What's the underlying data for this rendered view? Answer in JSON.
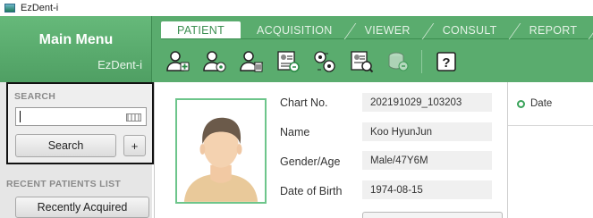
{
  "app": {
    "title": "EzDent-i"
  },
  "main_menu": {
    "title": "Main Menu",
    "subtitle": "EzDent-i"
  },
  "tabs": [
    {
      "label": "PATIENT",
      "active": true
    },
    {
      "label": "ACQUISITION",
      "active": false
    },
    {
      "label": "VIEWER",
      "active": false
    },
    {
      "label": "CONSULT",
      "active": false
    },
    {
      "label": "REPORT",
      "active": false
    }
  ],
  "toolbar_icons": [
    "add-patient-icon",
    "edit-patient-icon",
    "delete-patient-icon",
    "patient-card-icon",
    "share-patients-icon",
    "search-record-icon",
    "database-icon",
    "help-icon"
  ],
  "sidebar": {
    "search_section": "SEARCH",
    "search_value": "",
    "search_button": "Search",
    "plus_button": "+",
    "recent_section": "RECENT PATIENTS LIST",
    "recent_button": "Recently Acquired"
  },
  "patient": {
    "fields": [
      {
        "label": "Chart No.",
        "value": "202191029_103203"
      },
      {
        "label": "Name",
        "value": "Koo HyunJun"
      },
      {
        "label": "Gender/Age",
        "value": "Male/47Y6M"
      },
      {
        "label": "Date of Birth",
        "value": "1974-08-15"
      }
    ]
  },
  "date_panel": {
    "label": "Date"
  },
  "colors": {
    "header_green": "#5aac6e",
    "accent_green": "#3aa35a",
    "photo_border": "#6dc58b"
  }
}
